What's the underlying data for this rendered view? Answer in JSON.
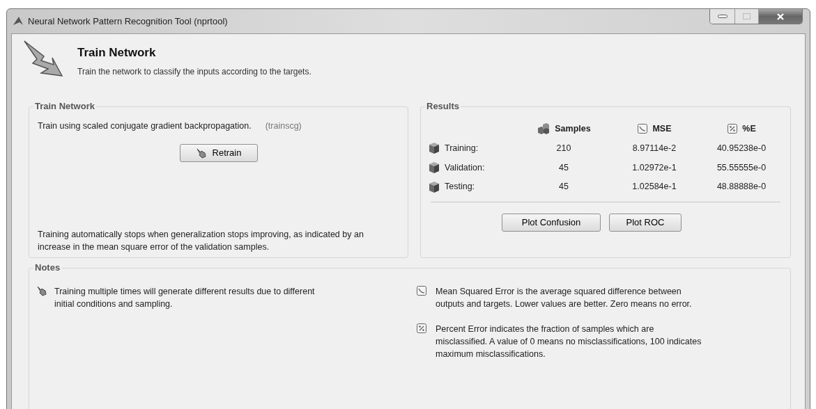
{
  "window": {
    "title": "Neural Network Pattern Recognition Tool (nprtool)"
  },
  "header": {
    "title": "Train Network",
    "subtitle": "Train the network to classify the inputs according to the targets."
  },
  "train_group": {
    "title": "Train Network",
    "method": "Train using scaled conjugate gradient backpropagation.",
    "function": "(trainscg)",
    "button": "Retrain",
    "note": "Training automatically stops when generalization stops improving, as indicated by an increase in the mean square error of the validation samples."
  },
  "results_group": {
    "title": "Results",
    "columns": [
      "Samples",
      "MSE",
      "%E"
    ],
    "rows": [
      {
        "label": "Training:",
        "cells": [
          "210",
          "8.97114e-2",
          "40.95238e-0"
        ]
      },
      {
        "label": "Validation:",
        "cells": [
          "45",
          "1.02972e-1",
          "55.55555e-0"
        ]
      },
      {
        "label": "Testing:",
        "cells": [
          "45",
          "1.02584e-1",
          "48.88888e-0"
        ]
      }
    ],
    "buttons": [
      "Plot Confusion",
      "Plot ROC"
    ]
  },
  "notes_group": {
    "title": "Notes",
    "left": [
      "Training multiple times will generate different results due to different initial conditions and sampling."
    ],
    "right": [
      "Mean Squared Error is the average squared difference between outputs and targets. Lower values are better. Zero means no error.",
      "Percent Error  indicates the fraction of samples which are misclassified. A value of 0 means no misclassifications, 100 indicates maximum misclassifications."
    ]
  }
}
